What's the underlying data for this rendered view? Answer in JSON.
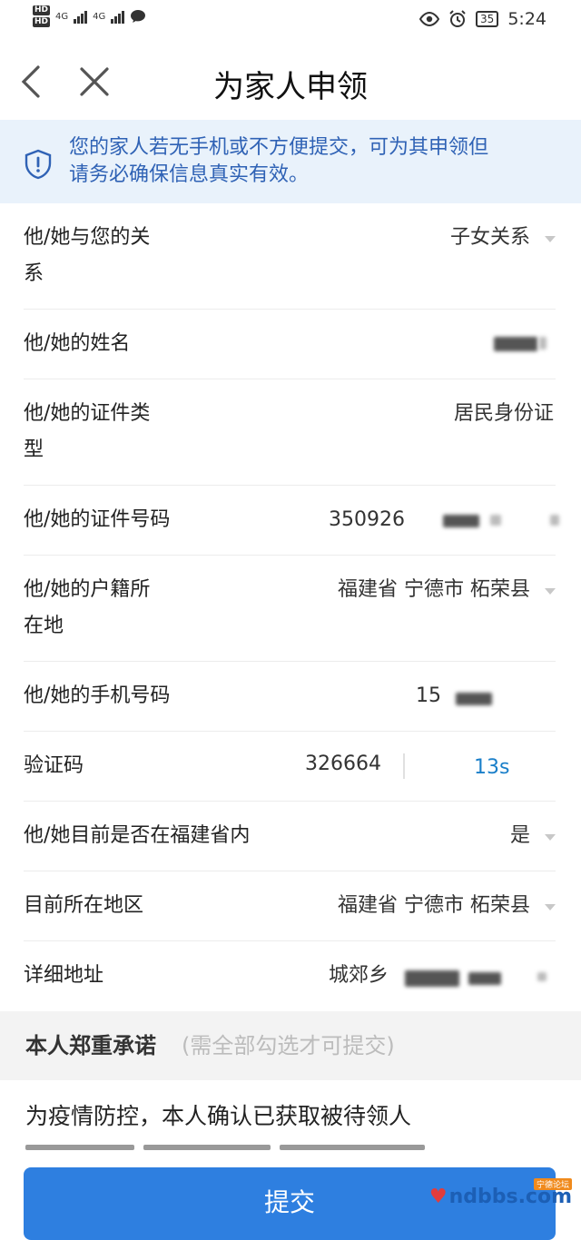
{
  "status_bar": {
    "hd1": "HD",
    "hd2": "HD",
    "net1": "4G",
    "net2": "4G",
    "battery": "35",
    "time": "5:24"
  },
  "nav": {
    "title": "为家人申领",
    "back_icon": "chevron-left-icon",
    "close_icon": "close-icon"
  },
  "notice": {
    "icon": "shield-icon",
    "line1": "您的家人若无手机或不方便提交，可为其申领但",
    "line2": "请务必确保信息真实有效。",
    "color": "#2f62b5",
    "bg": "#e9f2fb"
  },
  "form": {
    "relation": {
      "label_line1": "他/她与您的关",
      "label_line2": "系",
      "value": "子女关系"
    },
    "name": {
      "label": "他/她的姓名"
    },
    "id_type": {
      "label_line1": "他/她的证件类",
      "label_line2": "型",
      "value": "居民身份证"
    },
    "id_number": {
      "label": "他/她的证件号码",
      "value": "350926"
    },
    "household": {
      "label_line1": "他/她的户籍所",
      "label_line2": "在地",
      "value": "福建省 宁德市 柘荣县"
    },
    "phone": {
      "label": "他/她的手机号码",
      "value": "15"
    },
    "code": {
      "label": "验证码",
      "value": "326664",
      "countdown": "13s"
    },
    "in_province": {
      "label": "他/她目前是否在福建省内",
      "value": "是"
    },
    "current_region": {
      "label": "目前所在地区",
      "value": "福建省 宁德市 柘荣县"
    },
    "address": {
      "label": "详细地址",
      "value": "城郊乡"
    }
  },
  "promise": {
    "title": "本人郑重承诺",
    "note": "(需全部勾选才可提交)",
    "body": "为疫情防控，本人确认已获取被待领人"
  },
  "submit": {
    "label": "提交",
    "color": "#2e7fe0"
  },
  "watermark": {
    "text": "ndbbs.com",
    "tag": "宁德论坛"
  }
}
